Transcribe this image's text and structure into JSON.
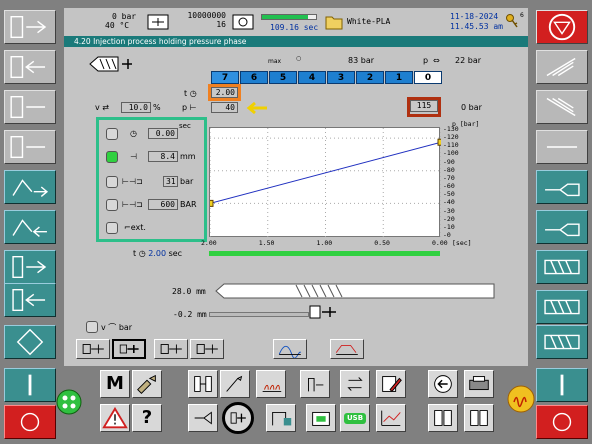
{
  "header": {
    "pressure_value": "0",
    "pressure_unit": "bar",
    "temperature_value": "40",
    "temperature_unit": "°C",
    "counter_total": "10000000",
    "counter_current": "16",
    "cycle_time": "109.16",
    "cycle_time_unit": "sec",
    "cycle_progress": 0.85,
    "material": "White-PLA",
    "date": "11-18-2024",
    "time": "11.45.53 am",
    "key_level": "6"
  },
  "title": "4.20 Injection process holding pressure phase",
  "stages": {
    "max_label": "max",
    "max_value": "83",
    "max_unit": "bar",
    "p_label": "p",
    "p_value": "22",
    "p_unit": "bar",
    "labels": [
      "7",
      "6",
      "5",
      "4",
      "3",
      "2",
      "1",
      "0"
    ]
  },
  "time_param": {
    "label": "t",
    "value": "2.00"
  },
  "pressure_param": {
    "label": "p",
    "value": "40"
  },
  "speed_param": {
    "label": "v",
    "value": "10.0",
    "unit": "%"
  },
  "right_pressure": {
    "value": "115",
    "actual": "0",
    "unit": "bar"
  },
  "controls": {
    "sec_label": "sec",
    "delay_value": "0.00",
    "stroke_value": "8.4",
    "stroke_unit": "mm",
    "pressure_value": "31",
    "pressure_unit": "bar",
    "limit_value": "600",
    "limit_unit": "BAR",
    "ext_label": "ext."
  },
  "chart_data": {
    "type": "line",
    "xlabel": "[sec]",
    "ylabel": "p [bar]",
    "x_ticks": [
      "2.00",
      "1.50",
      "1.00",
      "0.50",
      "0.00"
    ],
    "y_ticks": [
      "130",
      "120",
      "110",
      "100",
      "90",
      "80",
      "70",
      "60",
      "50",
      "40",
      "30",
      "20",
      "10",
      "0"
    ],
    "xlim": [
      2.0,
      0.0
    ],
    "ylim": [
      0,
      130
    ],
    "series": [
      {
        "x": [
          2.0,
          0.0
        ],
        "y": [
          40,
          115
        ]
      }
    ]
  },
  "footer_time": {
    "label": "t",
    "value": "2.00",
    "unit": "sec"
  },
  "screw": {
    "position_value": "28.0",
    "position_unit": "mm",
    "cushion_value": "-0.2",
    "cushion_unit": "mm"
  },
  "v_bar": {
    "label": "v",
    "unit": "bar"
  },
  "toolbar": {
    "m_label": "M",
    "question_label": "?",
    "usb_label": "USB"
  }
}
